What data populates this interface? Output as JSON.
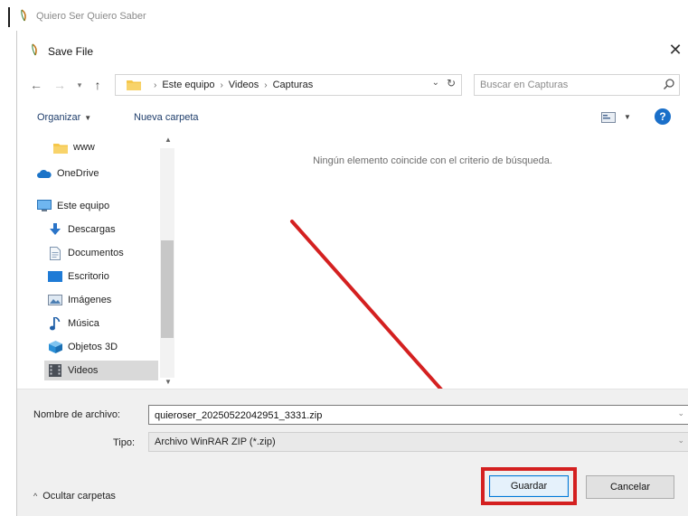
{
  "parent_window": {
    "title": "Quiero Ser Quiero Saber"
  },
  "dialog": {
    "title": "Save File",
    "close_label": "✕"
  },
  "address_bar": {
    "segments": [
      "Este equipo",
      "Videos",
      "Capturas"
    ],
    "separator": "›",
    "search_placeholder": "Buscar en Capturas"
  },
  "toolbar": {
    "organize_label": "Organizar",
    "new_folder_label": "Nueva carpeta",
    "help_label": "?"
  },
  "nav_pane": {
    "items": [
      {
        "label": "www",
        "icon": "folder-icon"
      },
      {
        "label": "OneDrive",
        "icon": "cloud-icon"
      },
      {
        "label": "Este equipo",
        "icon": "computer-icon"
      },
      {
        "label": "Descargas",
        "icon": "download-icon"
      },
      {
        "label": "Documentos",
        "icon": "document-icon"
      },
      {
        "label": "Escritorio",
        "icon": "desktop-icon"
      },
      {
        "label": "Imágenes",
        "icon": "pictures-icon"
      },
      {
        "label": "Música",
        "icon": "music-icon"
      },
      {
        "label": "Objetos 3D",
        "icon": "objects3d-icon"
      },
      {
        "label": "Videos",
        "icon": "videos-icon",
        "selected": true
      }
    ]
  },
  "content": {
    "empty_message": "Ningún elemento coincide con el criterio de búsqueda."
  },
  "footer": {
    "filename_label": "Nombre de archivo:",
    "filename_value": "quieroser_20250522042951_3331.zip",
    "type_label": "Tipo:",
    "type_value": "Archivo WinRAR ZIP (*.zip)",
    "hide_folders_label": "Ocultar carpetas",
    "save_label": "Guardar",
    "cancel_label": "Cancelar"
  },
  "colors": {
    "highlight_red": "#d42020",
    "link_blue": "#1e3d6b",
    "accent_blue": "#0078d7",
    "help_blue": "#1a6fc9",
    "folder_yellow": "#f5c74a"
  }
}
